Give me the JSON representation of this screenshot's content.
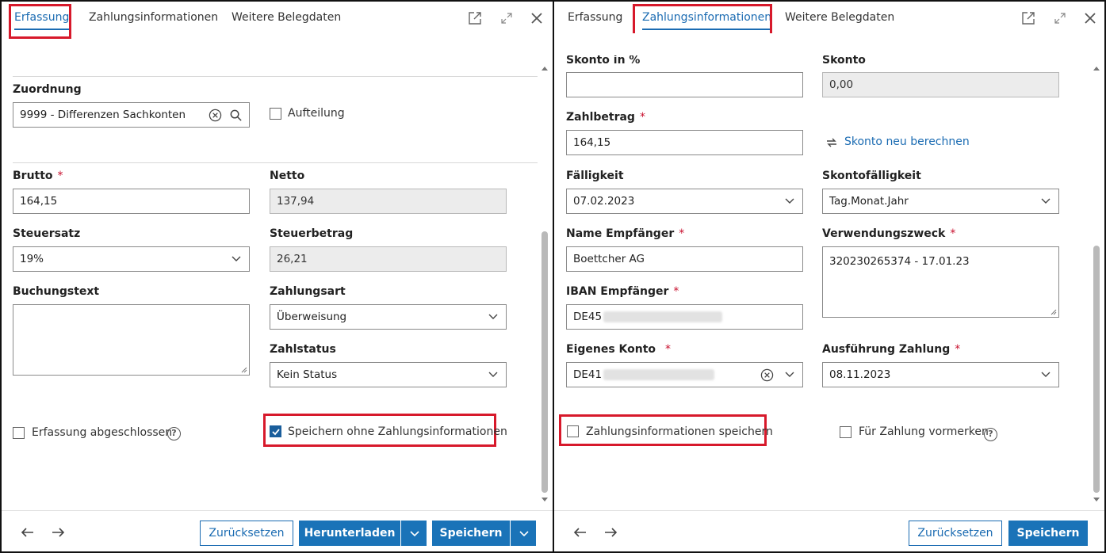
{
  "left": {
    "tabs": [
      "Erfassung",
      "Zahlungsinformationen",
      "Weitere Belegdaten"
    ],
    "zuordnung": {
      "label": "Zuordnung",
      "value": "9999 - Differenzen Sachkonten"
    },
    "aufteilung": "Aufteilung",
    "brutto": {
      "label": "Brutto",
      "value": "164,15"
    },
    "netto": {
      "label": "Netto",
      "value": "137,94"
    },
    "steuersatz": {
      "label": "Steuersatz",
      "value": "19%"
    },
    "steuerbetrag": {
      "label": "Steuerbetrag",
      "value": "26,21"
    },
    "buchungstext": {
      "label": "Buchungstext",
      "value": ""
    },
    "zahlungsart": {
      "label": "Zahlungsart",
      "value": "Überweisung"
    },
    "zahlstatus": {
      "label": "Zahlstatus",
      "value": "Kein Status"
    },
    "erfassung_abgeschlossen": "Erfassung abgeschlossen",
    "speichern_ohne": "Speichern ohne Zahlungsinformationen",
    "required_mark": "*",
    "help": "?",
    "footer": {
      "reset": "Zurücksetzen",
      "download": "Herunterladen",
      "save": "Speichern"
    }
  },
  "right": {
    "tabs": [
      "Erfassung",
      "Zahlungsinformationen",
      "Weitere Belegdaten"
    ],
    "skonto_pct": {
      "label": "Skonto in %",
      "value": ""
    },
    "skonto": {
      "label": "Skonto",
      "value": "0,00"
    },
    "zahlbetrag": {
      "label": "Zahlbetrag",
      "value": "164,15"
    },
    "skonto_neu": "Skonto neu berechnen",
    "faelligkeit": {
      "label": "Fälligkeit",
      "value": "07.02.2023"
    },
    "skontofaelligkeit": {
      "label": "Skontofälligkeit",
      "value": "Tag.Monat.Jahr"
    },
    "name_empfaenger": {
      "label": "Name Empfänger",
      "value": "Boettcher AG"
    },
    "verwendungszweck": {
      "label": "Verwendungszweck",
      "value": "320230265374 - 17.01.23"
    },
    "iban_empfaenger": {
      "label": "IBAN Empfänger",
      "value": "DE45"
    },
    "eigenes_konto": {
      "label": "Eigenes Konto",
      "value": "DE41"
    },
    "ausfuehrung": {
      "label": "Ausführung Zahlung",
      "value": "08.11.2023"
    },
    "zahlungsinfo_speichern": "Zahlungsinformationen speichern",
    "fuer_zahlung": "Für Zahlung vormerken",
    "required_mark": "*",
    "help": "?",
    "footer": {
      "reset": "Zurücksetzen",
      "save": "Speichern"
    }
  },
  "colors": {
    "accent": "#1a73b8",
    "highlight": "#d7192b",
    "required": "#c8102e"
  }
}
